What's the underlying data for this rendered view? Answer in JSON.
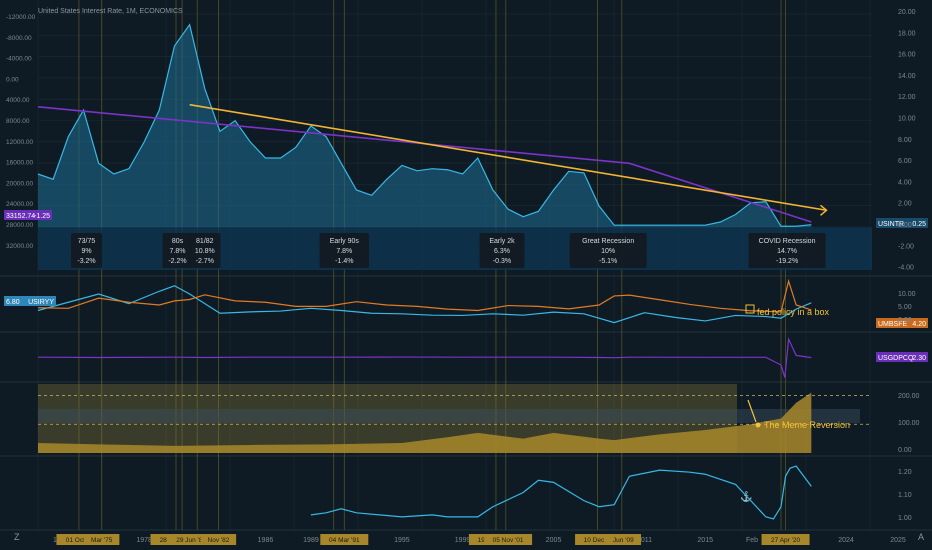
{
  "colors": {
    "bg": "#0f1b24",
    "grid": "#1c2a35",
    "rate_line": "#37b8e6",
    "rate_fill": "#1e6d94",
    "trend_purple": "#7b33c9",
    "trend_yellow": "#f2b431",
    "orange": "#e07b24",
    "gold": "#a8872a",
    "annotation_yellow": "#f2c23a",
    "tag_bg": "#131a20",
    "purple_badge": "#6a2fb8",
    "label_blue": "#2f86b8",
    "orange_badge": "#c96a1c"
  },
  "header": {
    "title": "United States Interest Rate, 1M, ECONOMICS"
  },
  "sidebar_left": {
    "z_label": "Z",
    "top_labels": [
      "-12000.00",
      "-8000.00",
      "-4000.00",
      "0.00",
      "4000.00",
      "8000.00",
      "12000.00",
      "16000.00",
      "20000.00",
      "24000.00",
      "28000.00",
      "32000.00"
    ]
  },
  "right_axis": {
    "main_ticks": [
      "20.00",
      "18.00",
      "16.00",
      "14.00",
      "12.00",
      "10.00",
      "8.00",
      "6.00",
      "4.00",
      "2.00",
      "0.00",
      "-2.00",
      "-4.00"
    ],
    "pane2_ticks": [
      "10.00",
      "5.00",
      "0.00"
    ],
    "pane4_ticks": [
      "200.00",
      "100.00",
      "0.00"
    ],
    "pane5_ticks": [
      "1.20",
      "1.10",
      "1.00"
    ],
    "auto_label": "A"
  },
  "badges": {
    "usintr": {
      "name": "USINTR",
      "value": "0.25"
    },
    "usiryy": {
      "name": "USIRYY",
      "value": "6.80"
    },
    "umbsfe": {
      "name": "UMBSFE",
      "value": "4.20"
    },
    "usgdpcq": {
      "name": "USGDPCQ",
      "value": "2.30"
    },
    "left_purple": {
      "value": "33152.74",
      "extra": "-1.25"
    }
  },
  "annotations": {
    "fed_policy": "fed policy in a box",
    "meme_reversion": "The Meme Reversion"
  },
  "recessions": [
    {
      "name": "73/75",
      "rate": "9%",
      "gdp": "-3.2%"
    },
    {
      "name": "80s",
      "rate": "7.8%",
      "gdp": "-2.2%"
    },
    {
      "name": "81/82",
      "rate": "10.8%",
      "gdp": "-2.7%"
    },
    {
      "name": "Early 90s",
      "rate": "7.8%",
      "gdp": "-1.4%"
    },
    {
      "name": "Early 2k",
      "rate": "6.3%",
      "gdp": "-0.3%"
    },
    {
      "name": "Great Recession",
      "rate": "10%",
      "gdp": "-5.1%"
    },
    {
      "name": "COVID Recession",
      "rate": "14.7%",
      "gdp": "-19.2%"
    }
  ],
  "time_axis": {
    "years": [
      "1972",
      "1978",
      "1986",
      "1989",
      "1995",
      "1999",
      "2005",
      "2011",
      "2015",
      "2023",
      "2024",
      "2025"
    ],
    "feb_label": "Feb",
    "highlight_dates": [
      "01 Oct '73",
      "Mar '75",
      "28 Jan '80",
      "29 Jun '81",
      "Nov '82",
      "02",
      "04 Mar '91",
      "19 Mar '01",
      "05 Nov '01",
      "10 Dec '07",
      "Jun '09",
      "27 Apr '20"
    ]
  },
  "chart_data": [
    {
      "type": "area",
      "series": [
        {
          "name": "USINTR",
          "x": [
            1971,
            1972,
            1973,
            1974,
            1975,
            1976,
            1977,
            1978,
            1979,
            1980,
            1981,
            1982,
            1983,
            1984,
            1985,
            1986,
            1987,
            1988,
            1989,
            1990,
            1991,
            1992,
            1993,
            1994,
            1995,
            1996,
            1997,
            1998,
            1999,
            2000,
            2001,
            2002,
            2003,
            2004,
            2005,
            2006,
            2007,
            2008,
            2009,
            2010,
            2015,
            2016,
            2017,
            2018,
            2019,
            2020,
            2021,
            2022
          ],
          "y": [
            5,
            4.5,
            8.5,
            11,
            6,
            5,
            5.5,
            8,
            11,
            17,
            19,
            13,
            9,
            10,
            8,
            6.5,
            6.5,
            7.5,
            9.5,
            8.5,
            6,
            3.5,
            3,
            4.5,
            5.8,
            5.3,
            5.5,
            5.4,
            5,
            6.5,
            3.5,
            1.7,
            1,
            1.5,
            3.5,
            5.25,
            5.1,
            2,
            0.2,
            0.2,
            0.2,
            0.5,
            1.2,
            2.3,
            2.4,
            0.1,
            0.1,
            0.25
          ]
        }
      ],
      "trend_lines": [
        {
          "name": "purple",
          "points": [
            [
              1971,
              11.3
            ],
            [
              2010,
              6.0
            ],
            [
              2022,
              0.5
            ]
          ]
        },
        {
          "name": "yellow",
          "points": [
            [
              1981,
              11.5
            ],
            [
              2023,
              1.6
            ]
          ]
        }
      ],
      "ylim": [
        -4,
        20
      ]
    },
    {
      "type": "line",
      "series": [
        {
          "name": "USIRYY",
          "x": [
            1971,
            1973,
            1975,
            1977,
            1979,
            1980,
            1981,
            1983,
            1985,
            1987,
            1989,
            1991,
            1993,
            1995,
            1997,
            1999,
            2001,
            2003,
            2005,
            2007,
            2009,
            2011,
            2013,
            2015,
            2017,
            2019,
            2020,
            2021,
            2022
          ],
          "y": [
            4,
            7,
            10,
            6.5,
            11,
            13,
            10,
            3,
            3.5,
            3.8,
            4.8,
            4,
            3,
            2.8,
            2.3,
            2.2,
            2.8,
            2.3,
            3.4,
            2.8,
            -0.4,
            3.2,
            1.5,
            0.2,
            2.2,
            1.8,
            1.2,
            4.5,
            6.8
          ]
        },
        {
          "name": "UMBSFE",
          "x": [
            1971,
            1973,
            1975,
            1977,
            1979,
            1980,
            1981,
            1982,
            1984,
            1986,
            1988,
            1990,
            1992,
            1994,
            1996,
            1998,
            2000,
            2002,
            2004,
            2006,
            2008,
            2009,
            2010,
            2012,
            2014,
            2016,
            2018,
            2019,
            2020,
            2020.5,
            2021,
            2022
          ],
          "y": [
            5,
            4.8,
            8.5,
            7,
            6,
            7.5,
            8,
            9.7,
            7.5,
            7,
            5.5,
            5.5,
            7.2,
            6,
            5.5,
            4.5,
            4,
            5.8,
            5.5,
            4.6,
            6,
            9.3,
            9.6,
            7.9,
            6.2,
            4.8,
            3.9,
            3.7,
            3.5,
            14.7,
            6,
            4.2
          ]
        }
      ],
      "ylim": [
        -2,
        14
      ]
    },
    {
      "type": "line",
      "series": [
        {
          "name": "USGDPCQ",
          "x": [
            1971,
            1975,
            1980,
            1982,
            1985,
            1990,
            1995,
            2000,
            2005,
            2008,
            2009,
            2010,
            2015,
            2019,
            2020,
            2020.25,
            2020.5,
            2021,
            2022
          ],
          "y": [
            3,
            2.5,
            3,
            2.5,
            3,
            3,
            3.2,
            3,
            3,
            2.5,
            2.2,
            3,
            2.8,
            2.8,
            -10,
            -31,
            33,
            6,
            2.3
          ]
        }
      ],
      "ylim": [
        -35,
        35
      ]
    },
    {
      "type": "bar",
      "series": [
        {
          "name": "ratio",
          "x": [
            1971,
            1975,
            1980,
            1985,
            1990,
            1995,
            1998,
            2000,
            2003,
            2005,
            2008,
            2009,
            2012,
            2015,
            2018,
            2020,
            2021,
            2022
          ],
          "y": [
            35,
            30,
            25,
            28,
            30,
            35,
            55,
            70,
            50,
            70,
            50,
            45,
            65,
            80,
            100,
            120,
            175,
            210
          ]
        }
      ],
      "ylim": [
        0,
        240
      ]
    },
    {
      "type": "line",
      "series": [
        {
          "name": "ratio2",
          "x": [
            1989,
            1990,
            1991,
            1992,
            1995,
            1997,
            1998,
            2000,
            2001,
            2003,
            2004,
            2005,
            2007,
            2008,
            2009,
            2010,
            2012,
            2014,
            2015,
            2017,
            2018,
            2019,
            2019.5,
            2020,
            2020.3,
            2020.6,
            2021,
            2021.5,
            2022
          ],
          "y": [
            1.01,
            1.02,
            1.04,
            1.02,
            1.0,
            1.01,
            1.0,
            1.0,
            1.05,
            1.12,
            1.18,
            1.17,
            1.08,
            1.05,
            1.06,
            1.2,
            1.23,
            1.22,
            1.21,
            1.16,
            1.08,
            1.0,
            0.99,
            1.05,
            1.2,
            1.24,
            1.25,
            1.2,
            1.15
          ]
        }
      ],
      "ylim": [
        0.96,
        1.28
      ]
    }
  ]
}
